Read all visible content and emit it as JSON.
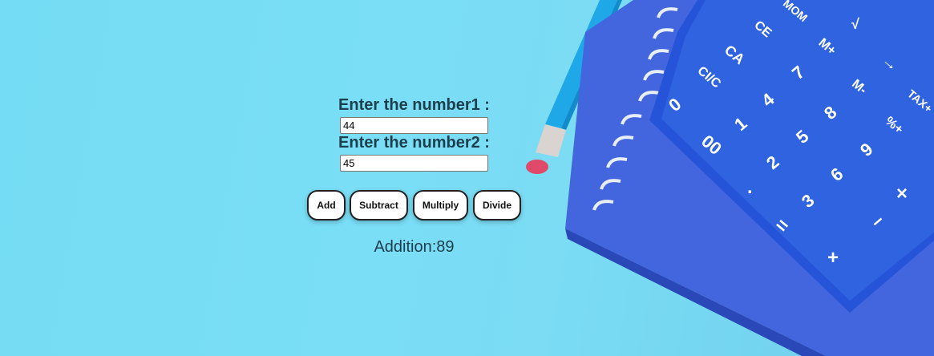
{
  "form": {
    "label1": "Enter the number1 :",
    "value1": "44",
    "label2": "Enter the number2 :",
    "value2": "45"
  },
  "buttons": {
    "add": "Add",
    "subtract": "Subtract",
    "multiply": "Multiply",
    "divide": "Divide"
  },
  "result": "Addition:89",
  "calculator_keys": {
    "mem": "MOM",
    "ce": "CE",
    "sqrt": "√",
    "ca": "CA",
    "m_plus": "M+",
    "arrow": "→",
    "ci_c": "CI/C",
    "seven": "7",
    "m_minus": "M-",
    "tax": "TAX+",
    "zero": "0",
    "four": "4",
    "eight": "8",
    "percent": "%+",
    "one": "1",
    "five": "5",
    "nine": "9",
    "double_zero": "00",
    "two": "2",
    "six": "6",
    "times": "×",
    "dot": ".",
    "three": "3",
    "minus": "–",
    "equals": "=",
    "plus": "+"
  },
  "colors": {
    "background": "#7bdcf4",
    "calculator": "#2f5fd6",
    "notebook": "#3b6ae0",
    "pencil": "#1fa8e8"
  }
}
